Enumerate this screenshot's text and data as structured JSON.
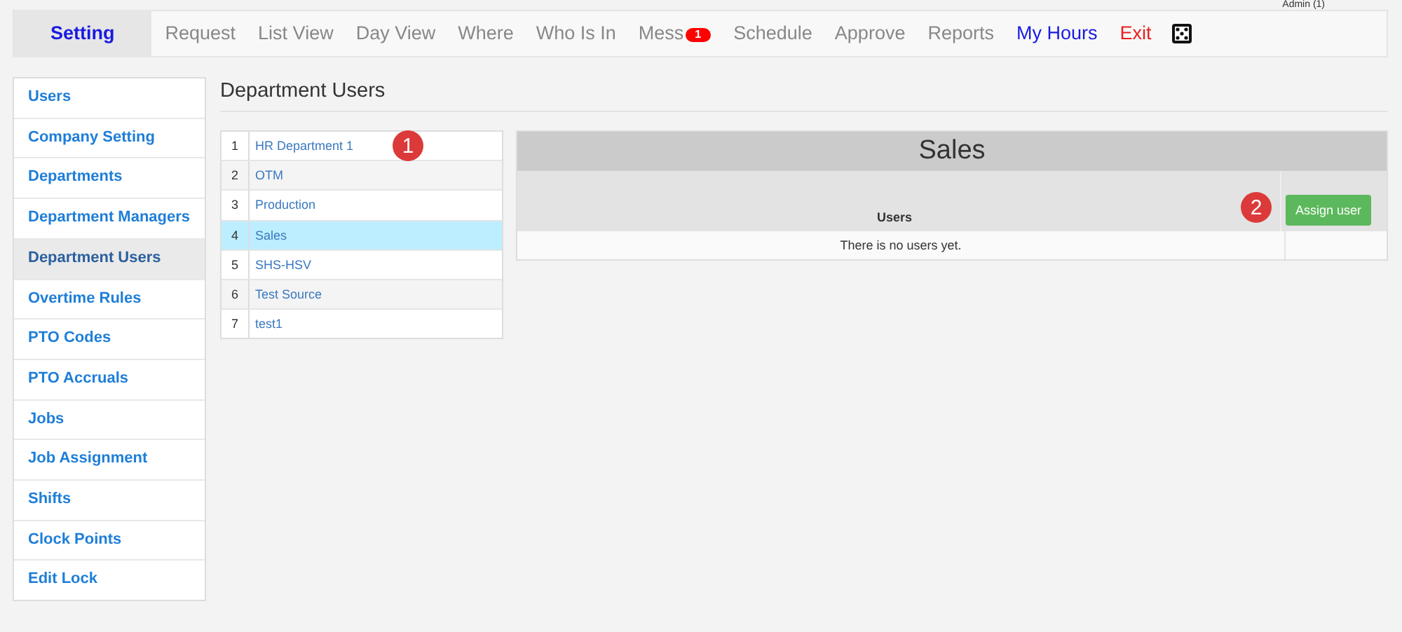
{
  "user_label": "Admin (1)",
  "nav": [
    {
      "label": "Setting",
      "selected": true,
      "kind": "normal"
    },
    {
      "label": "Request",
      "selected": false,
      "kind": "normal"
    },
    {
      "label": "List View",
      "selected": false,
      "kind": "normal"
    },
    {
      "label": "Day View",
      "selected": false,
      "kind": "normal"
    },
    {
      "label": "Where",
      "selected": false,
      "kind": "normal"
    },
    {
      "label": "Who Is In",
      "selected": false,
      "kind": "normal"
    },
    {
      "label": "Mess",
      "selected": false,
      "kind": "normal",
      "badge": "1"
    },
    {
      "label": "Schedule",
      "selected": false,
      "kind": "normal"
    },
    {
      "label": "Approve",
      "selected": false,
      "kind": "normal"
    },
    {
      "label": "Reports",
      "selected": false,
      "kind": "normal"
    },
    {
      "label": "My Hours",
      "selected": false,
      "kind": "accent"
    },
    {
      "label": "Exit",
      "selected": false,
      "kind": "danger"
    }
  ],
  "sidebar": {
    "items": [
      {
        "label": "Users",
        "selected": false
      },
      {
        "label": "Company Setting",
        "selected": false
      },
      {
        "label": "Departments",
        "selected": false
      },
      {
        "label": "Department Managers",
        "selected": false
      },
      {
        "label": "Department Users",
        "selected": true
      },
      {
        "label": "Overtime Rules",
        "selected": false
      },
      {
        "label": "PTO Codes",
        "selected": false
      },
      {
        "label": "PTO Accruals",
        "selected": false
      },
      {
        "label": "Jobs",
        "selected": false
      },
      {
        "label": "Job Assignment",
        "selected": false
      },
      {
        "label": "Shifts",
        "selected": false
      },
      {
        "label": "Clock Points",
        "selected": false
      },
      {
        "label": "Edit Lock",
        "selected": false
      }
    ]
  },
  "page_title": "Department Users",
  "departments": [
    {
      "num": "1",
      "name": "HR Department 1",
      "selected": false,
      "callout": "1"
    },
    {
      "num": "2",
      "name": "OTM",
      "selected": false
    },
    {
      "num": "3",
      "name": "Production",
      "selected": false
    },
    {
      "num": "4",
      "name": "Sales",
      "selected": true
    },
    {
      "num": "5",
      "name": "SHS-HSV",
      "selected": false
    },
    {
      "num": "6",
      "name": "Test Source",
      "selected": false
    },
    {
      "num": "7",
      "name": "test1",
      "selected": false
    }
  ],
  "detail": {
    "title": "Sales",
    "column": "Users",
    "callout": "2",
    "button": "Assign user",
    "empty_text": "There is no users yet."
  }
}
